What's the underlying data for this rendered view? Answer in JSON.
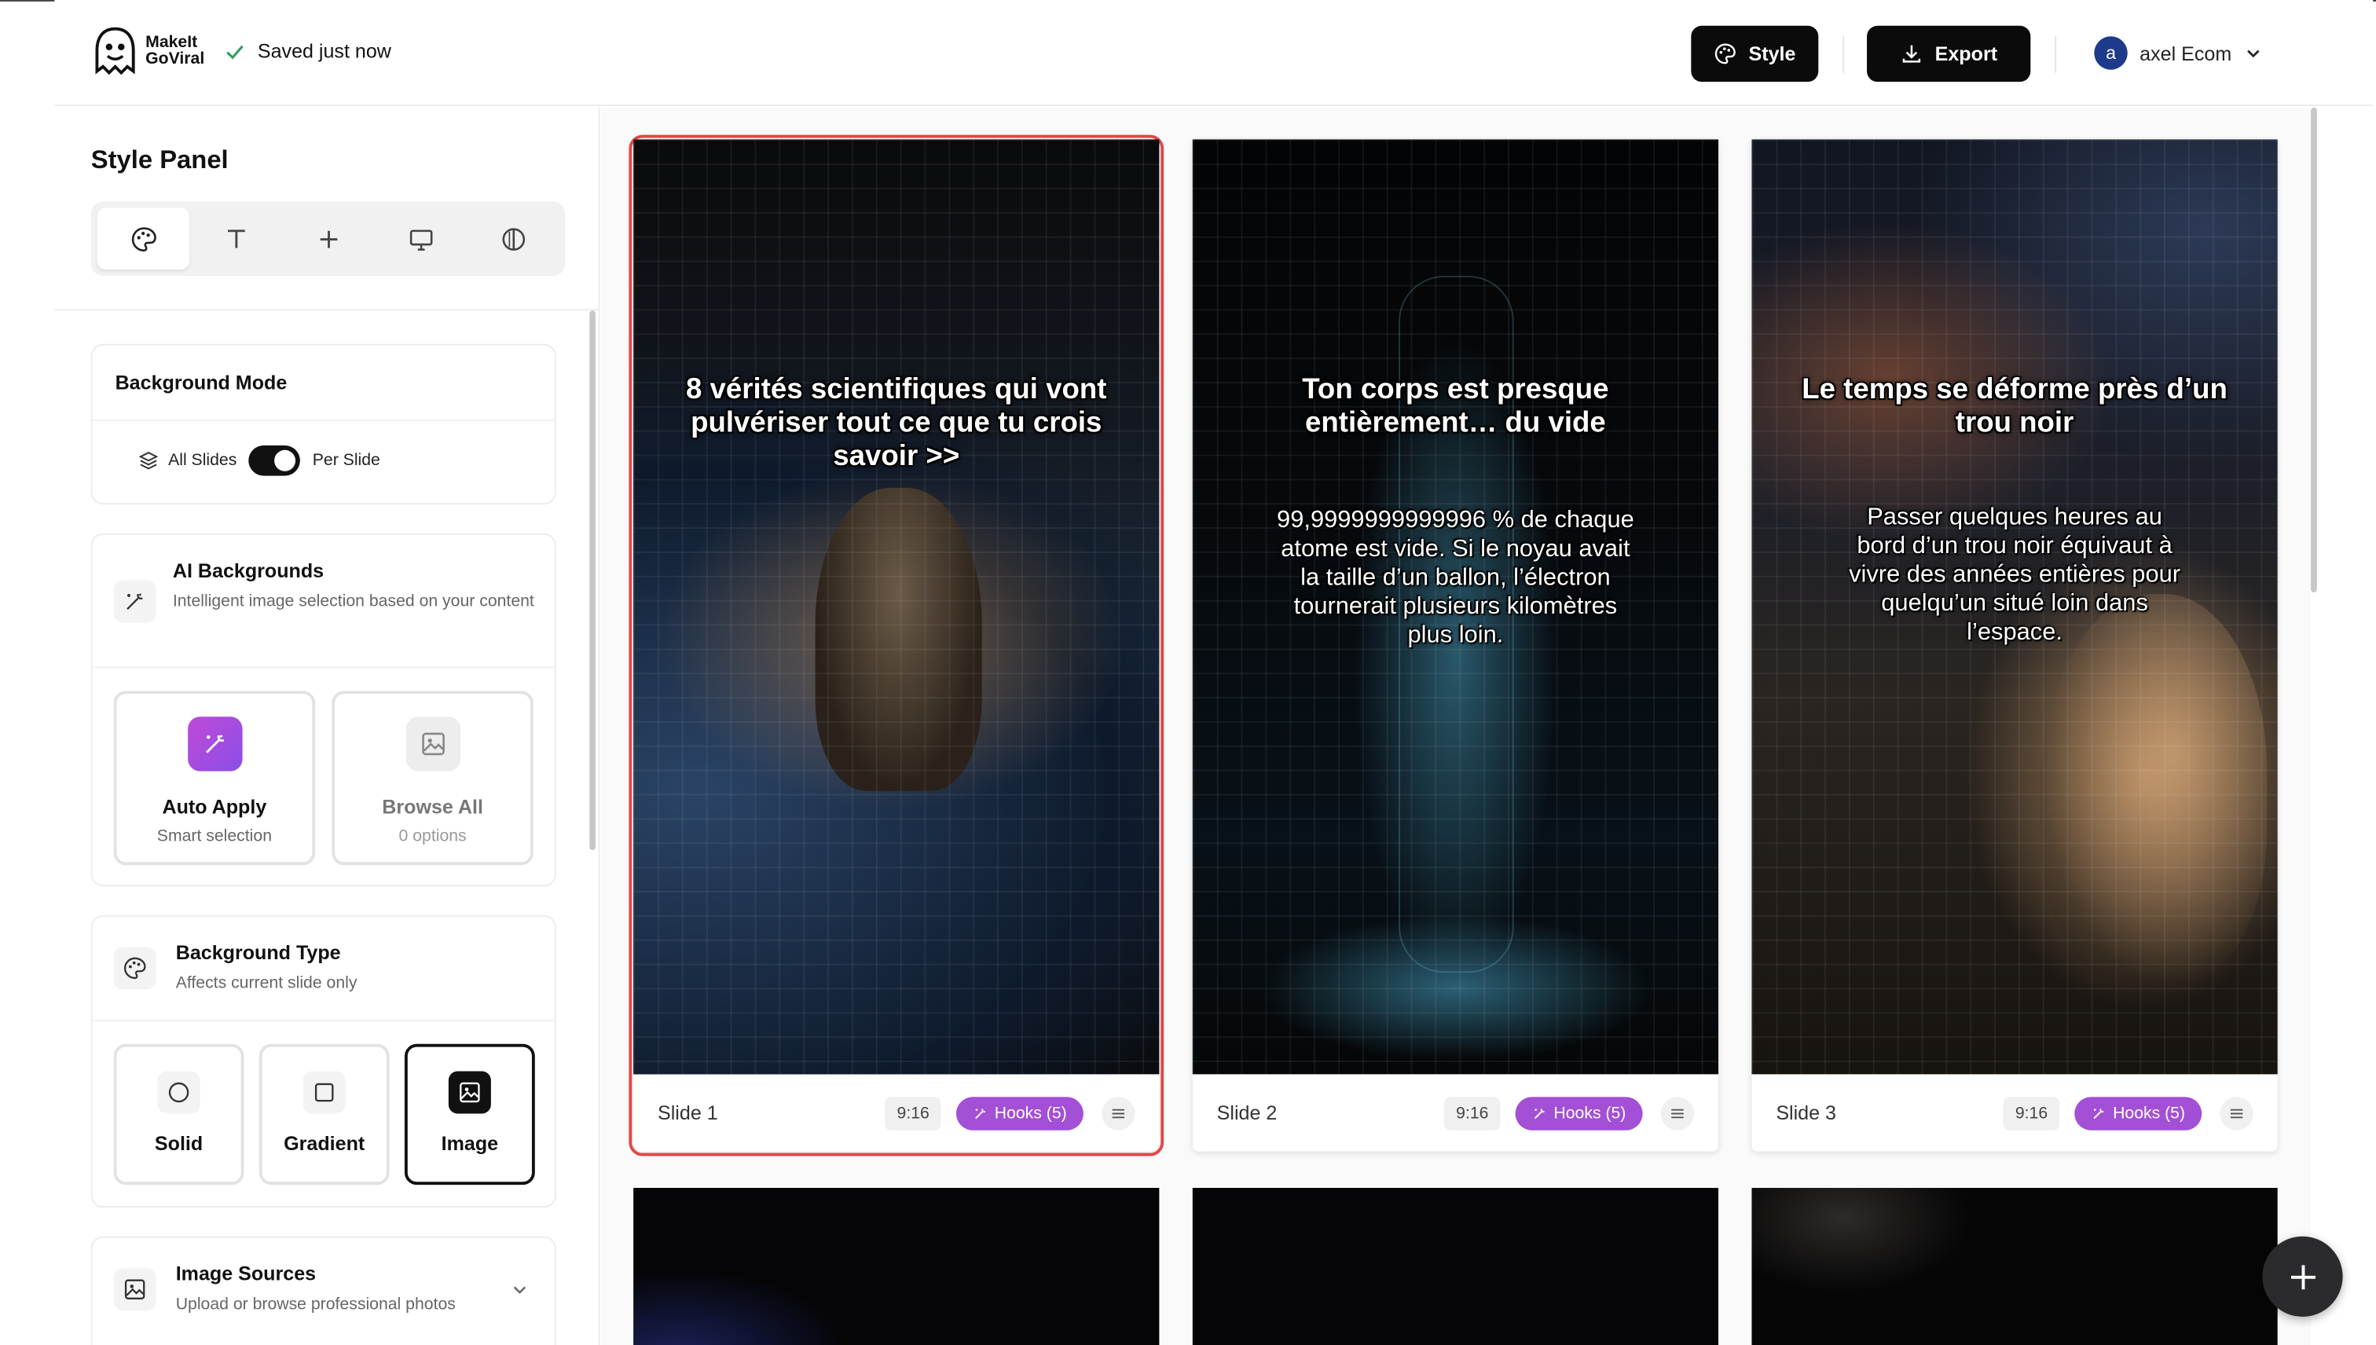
{
  "header": {
    "logo_line1": "MakeIt",
    "logo_line2": "GoViral",
    "saved_status": "Saved just now",
    "style_button": "Style",
    "export_button": "Export",
    "user_initial": "a",
    "user_name": "axel Ecom"
  },
  "sidebar": {
    "title": "Style Panel",
    "tabs": [
      "palette-icon",
      "text-icon",
      "plus-icon",
      "monitor-icon",
      "contrast-icon"
    ],
    "background_mode": {
      "title": "Background Mode",
      "all_slides": "All Slides",
      "per_slide": "Per Slide",
      "per_slide_enabled": true
    },
    "ai_backgrounds": {
      "title": "AI Backgrounds",
      "subtitle": "Intelligent image selection based on your content",
      "auto_apply_title": "Auto Apply",
      "auto_apply_sub": "Smart selection",
      "browse_all_title": "Browse All",
      "browse_all_sub": "0 options"
    },
    "background_type": {
      "title": "Background Type",
      "subtitle": "Affects current slide only",
      "options": [
        "Solid",
        "Gradient",
        "Image"
      ],
      "selected": "Image"
    },
    "image_sources": {
      "title": "Image Sources",
      "subtitle": "Upload or browse professional photos"
    }
  },
  "slides": [
    {
      "label": "Slide 1",
      "ratio": "9:16",
      "hooks": "Hooks (5)",
      "title": "8 vérités scientifiques qui vont pulvériser tout ce que tu crois savoir >>",
      "body": "",
      "selected": true
    },
    {
      "label": "Slide 2",
      "ratio": "9:16",
      "hooks": "Hooks (5)",
      "title": "Ton corps est presque entièrement… du vide",
      "body": "99,9999999999996 % de chaque atome est vide. Si le noyau avait la taille d’un ballon, l’électron tournerait plusieurs kilomètres plus loin.",
      "selected": false
    },
    {
      "label": "Slide 3",
      "ratio": "9:16",
      "hooks": "Hooks (5)",
      "title": "Le temps se déforme près d’un trou noir",
      "body": "Passer quelques heures au bord d’un trou noir équivaut à vivre des années entières pour quelqu’un situé loin dans l’espace.",
      "selected": false
    }
  ],
  "colors": {
    "accent_purple": "#a34fd6",
    "selection_red": "#e04848",
    "button_dark": "#0b0b0c"
  }
}
